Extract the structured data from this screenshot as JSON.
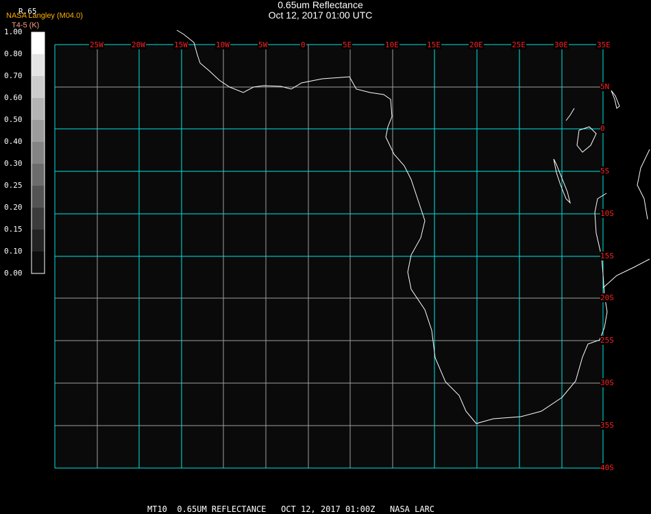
{
  "header": {
    "title": "0.65um Reflectance",
    "subtitle": "Oct 12, 2017 01:00 UTC"
  },
  "legend": {
    "product": "NASA Langley (M04.0)",
    "var_code": "R.65",
    "sub_label": "T4-5 (K)",
    "ticks": [
      "1.00",
      "0.80",
      "0.70",
      "0.60",
      "0.50",
      "0.40",
      "0.30",
      "0.25",
      "0.20",
      "0.15",
      "0.10",
      "0.00"
    ],
    "colors": [
      "#ffffff",
      "#e4e4e4",
      "#cccccc",
      "#b4b4b4",
      "#9c9c9c",
      "#848484",
      "#6c6c6c",
      "#545454",
      "#3c3c3c",
      "#242424",
      "#0c0c0c"
    ]
  },
  "map": {
    "lon_labels": [
      "25W",
      "20W",
      "15W",
      "10W",
      "5W",
      "0",
      "5E",
      "10E",
      "15E",
      "20E",
      "25E",
      "30E",
      "35E"
    ],
    "lat_labels": [
      "5N",
      "0",
      "5S",
      "10S",
      "15S",
      "20S",
      "25S",
      "30S",
      "35S",
      "40S"
    ],
    "grid_color": "#00e5e5",
    "label_color": "#ff2020",
    "background": "#0a0a0a"
  },
  "footer": {
    "text": "MT10  0.65UM REFLECTANCE   OCT 12, 2017 01:00Z   NASA LARC"
  }
}
